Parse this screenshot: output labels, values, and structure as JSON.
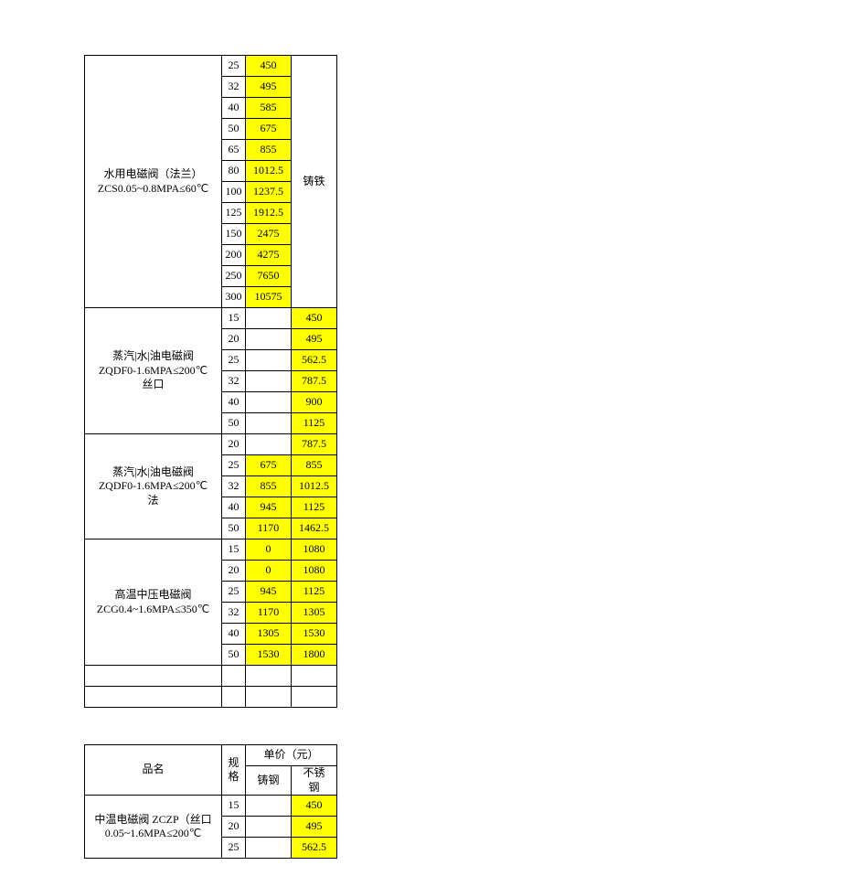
{
  "table1": {
    "col4_header": "铸铁",
    "groups": [
      {
        "name": "水用电磁阀（法兰）\nZCS0.05~0.8MPA≤60℃",
        "rows": [
          {
            "spec": "25",
            "p1": "450",
            "p1hl": true,
            "p2": "",
            "p2hl": false
          },
          {
            "spec": "32",
            "p1": "495",
            "p1hl": true,
            "p2": "",
            "p2hl": false
          },
          {
            "spec": "40",
            "p1": "585",
            "p1hl": true,
            "p2": "",
            "p2hl": false
          },
          {
            "spec": "50",
            "p1": "675",
            "p1hl": true,
            "p2": "",
            "p2hl": false
          },
          {
            "spec": "65",
            "p1": "855",
            "p1hl": true,
            "p2": "",
            "p2hl": false
          },
          {
            "spec": "80",
            "p1": "1012.5",
            "p1hl": true,
            "p2": "",
            "p2hl": false
          },
          {
            "spec": "100",
            "p1": "1237.5",
            "p1hl": true,
            "p2": "",
            "p2hl": false
          },
          {
            "spec": "125",
            "p1": "1912.5",
            "p1hl": true,
            "p2": "",
            "p2hl": false
          },
          {
            "spec": "150",
            "p1": "2475",
            "p1hl": true,
            "p2": "",
            "p2hl": false
          },
          {
            "spec": "200",
            "p1": "4275",
            "p1hl": true,
            "p2": "",
            "p2hl": false
          },
          {
            "spec": "250",
            "p1": "7650",
            "p1hl": true,
            "p2": "",
            "p2hl": false
          },
          {
            "spec": "300",
            "p1": "10575",
            "p1hl": true,
            "p2": "",
            "p2hl": false
          }
        ]
      },
      {
        "name": "蒸汽|水|油电磁阀\nZQDF0-1.6MPA≤200℃\n丝口",
        "rows": [
          {
            "spec": "15",
            "p1": "",
            "p1hl": false,
            "p2": "450",
            "p2hl": true
          },
          {
            "spec": "20",
            "p1": "",
            "p1hl": false,
            "p2": "495",
            "p2hl": true
          },
          {
            "spec": "25",
            "p1": "",
            "p1hl": false,
            "p2": "562.5",
            "p2hl": true
          },
          {
            "spec": "32",
            "p1": "",
            "p1hl": false,
            "p2": "787.5",
            "p2hl": true
          },
          {
            "spec": "40",
            "p1": "",
            "p1hl": false,
            "p2": "900",
            "p2hl": true
          },
          {
            "spec": "50",
            "p1": "",
            "p1hl": false,
            "p2": "1125",
            "p2hl": true
          }
        ]
      },
      {
        "name": "蒸汽|水|油电磁阀\nZQDF0-1.6MPA≤200℃\n法",
        "rows": [
          {
            "spec": "20",
            "p1": "",
            "p1hl": false,
            "p2": "787.5",
            "p2hl": true
          },
          {
            "spec": "25",
            "p1": "675",
            "p1hl": true,
            "p2": "855",
            "p2hl": true
          },
          {
            "spec": "32",
            "p1": "855",
            "p1hl": true,
            "p2": "1012.5",
            "p2hl": true
          },
          {
            "spec": "40",
            "p1": "945",
            "p1hl": true,
            "p2": "1125",
            "p2hl": true
          },
          {
            "spec": "50",
            "p1": "1170",
            "p1hl": true,
            "p2": "1462.5",
            "p2hl": true
          }
        ]
      },
      {
        "name": "高温中压电磁阀\nZCG0.4~1.6MPA≤350℃",
        "rows": [
          {
            "spec": "15",
            "p1": "0",
            "p1hl": true,
            "p2": "1080",
            "p2hl": true
          },
          {
            "spec": "20",
            "p1": "0",
            "p1hl": true,
            "p2": "1080",
            "p2hl": true
          },
          {
            "spec": "25",
            "p1": "945",
            "p1hl": true,
            "p2": "1125",
            "p2hl": true
          },
          {
            "spec": "32",
            "p1": "1170",
            "p1hl": true,
            "p2": "1305",
            "p2hl": true
          },
          {
            "spec": "40",
            "p1": "1305",
            "p1hl": true,
            "p2": "1530",
            "p2hl": true
          },
          {
            "spec": "50",
            "p1": "1530",
            "p1hl": true,
            "p2": "1800",
            "p2hl": true
          }
        ]
      }
    ]
  },
  "table2": {
    "head": {
      "name": "品名",
      "spec": "规\n格",
      "price": "单价（元）",
      "p1": "铸钢",
      "p2": "不锈\n钢"
    },
    "group_name": "中温电磁阀 ZCZP（丝口\n0.05~1.6MPA≤200℃",
    "rows": [
      {
        "spec": "15",
        "p1": "",
        "p1hl": false,
        "p2": "450",
        "p2hl": true
      },
      {
        "spec": "20",
        "p1": "",
        "p1hl": false,
        "p2": "495",
        "p2hl": true
      },
      {
        "spec": "25",
        "p1": "",
        "p1hl": false,
        "p2": "562.5",
        "p2hl": true
      }
    ]
  }
}
